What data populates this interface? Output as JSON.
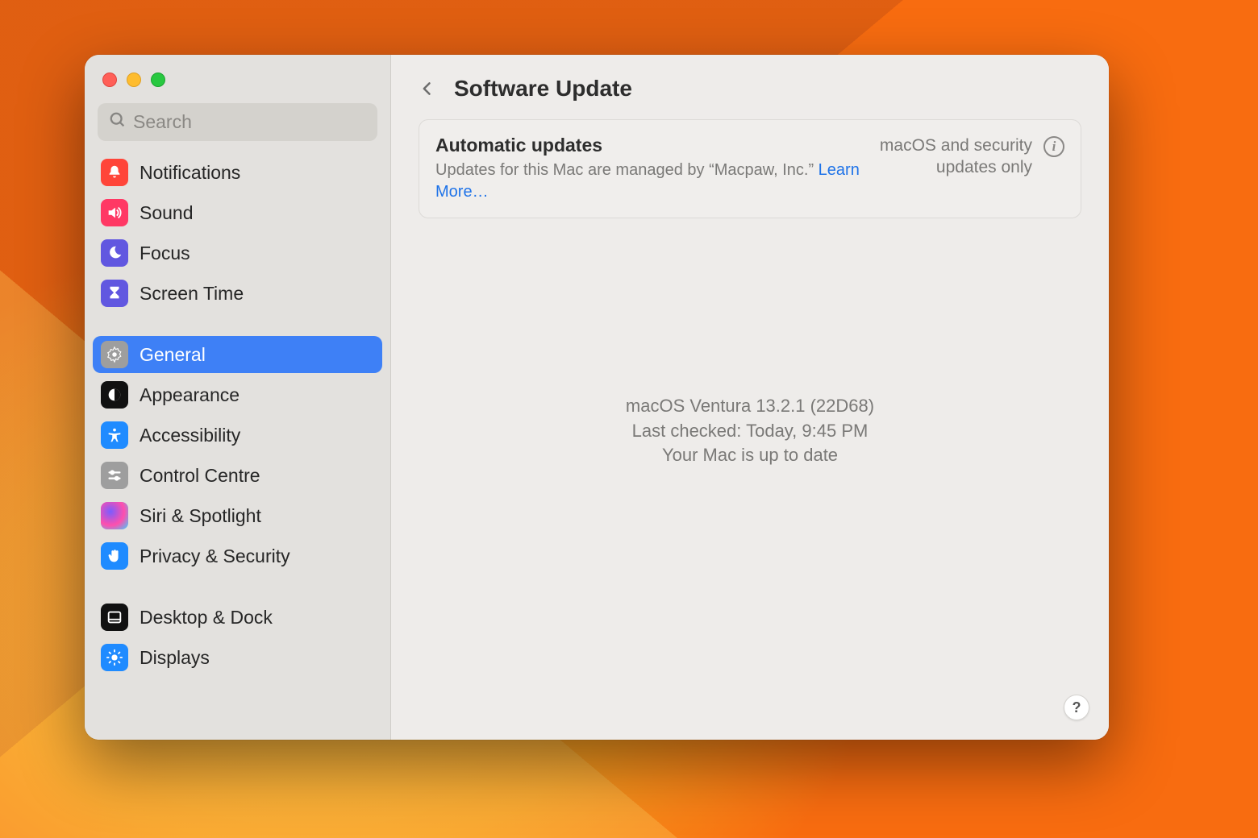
{
  "search": {
    "placeholder": "Search"
  },
  "sidebar": {
    "items": [
      {
        "label": "Notifications"
      },
      {
        "label": "Sound"
      },
      {
        "label": "Focus"
      },
      {
        "label": "Screen Time"
      },
      {
        "label": "General"
      },
      {
        "label": "Appearance"
      },
      {
        "label": "Accessibility"
      },
      {
        "label": "Control Centre"
      },
      {
        "label": "Siri & Spotlight"
      },
      {
        "label": "Privacy & Security"
      },
      {
        "label": "Desktop & Dock"
      },
      {
        "label": "Displays"
      }
    ]
  },
  "header": {
    "title": "Software Update"
  },
  "auto_updates": {
    "title": "Automatic updates",
    "desc_prefix": "Updates for this Mac are managed by “Macpaw, Inc.” ",
    "learn_more": "Learn More…",
    "status_line1": "macOS and security",
    "status_line2": "updates only"
  },
  "status": {
    "version": "macOS Ventura 13.2.1 (22D68)",
    "last_checked": "Last checked: Today, 9:45 PM",
    "summary": "Your Mac is up to date"
  },
  "help_label": "?"
}
